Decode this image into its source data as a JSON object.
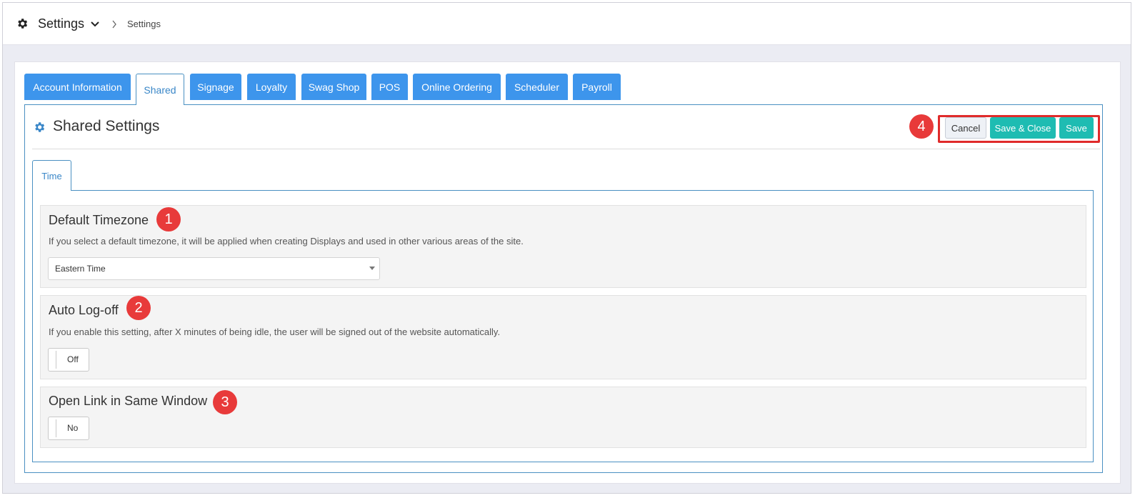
{
  "header": {
    "title": "Settings",
    "breadcrumb": "Settings",
    "icons": [
      "gear-icon",
      "chevron-down-icon",
      "chevron-right-icon"
    ]
  },
  "tabs": [
    {
      "label": "Account Information",
      "active": false
    },
    {
      "label": "Shared",
      "active": true
    },
    {
      "label": "Signage",
      "active": false
    },
    {
      "label": "Loyalty",
      "active": false
    },
    {
      "label": "Swag Shop",
      "active": false
    },
    {
      "label": "POS",
      "active": false
    },
    {
      "label": "Online Ordering",
      "active": false
    },
    {
      "label": "Scheduler",
      "active": false
    },
    {
      "label": "Payroll",
      "active": false
    }
  ],
  "panel": {
    "title": "Shared Settings",
    "actions": {
      "cancel": "Cancel",
      "save_close": "Save & Close",
      "save": "Save"
    },
    "subtab": "Time"
  },
  "sections": {
    "timezone": {
      "title": "Default Timezone",
      "description": "If you select a default timezone, it will be applied when creating Displays and used in other various areas of the site.",
      "value": "Eastern Time"
    },
    "autologoff": {
      "title": "Auto Log-off",
      "description": "If you enable this setting, after X minutes of being idle, the user will be signed out of the website automatically.",
      "toggle": "Off"
    },
    "samewindow": {
      "title": "Open Link in Same Window",
      "toggle": "No"
    }
  },
  "badges": [
    "1",
    "2",
    "3",
    "4"
  ],
  "colors": {
    "tab": "#3d95ec",
    "teal": "#1ebcb2",
    "badge": "#e83a3a",
    "border": "#4a90c2"
  }
}
